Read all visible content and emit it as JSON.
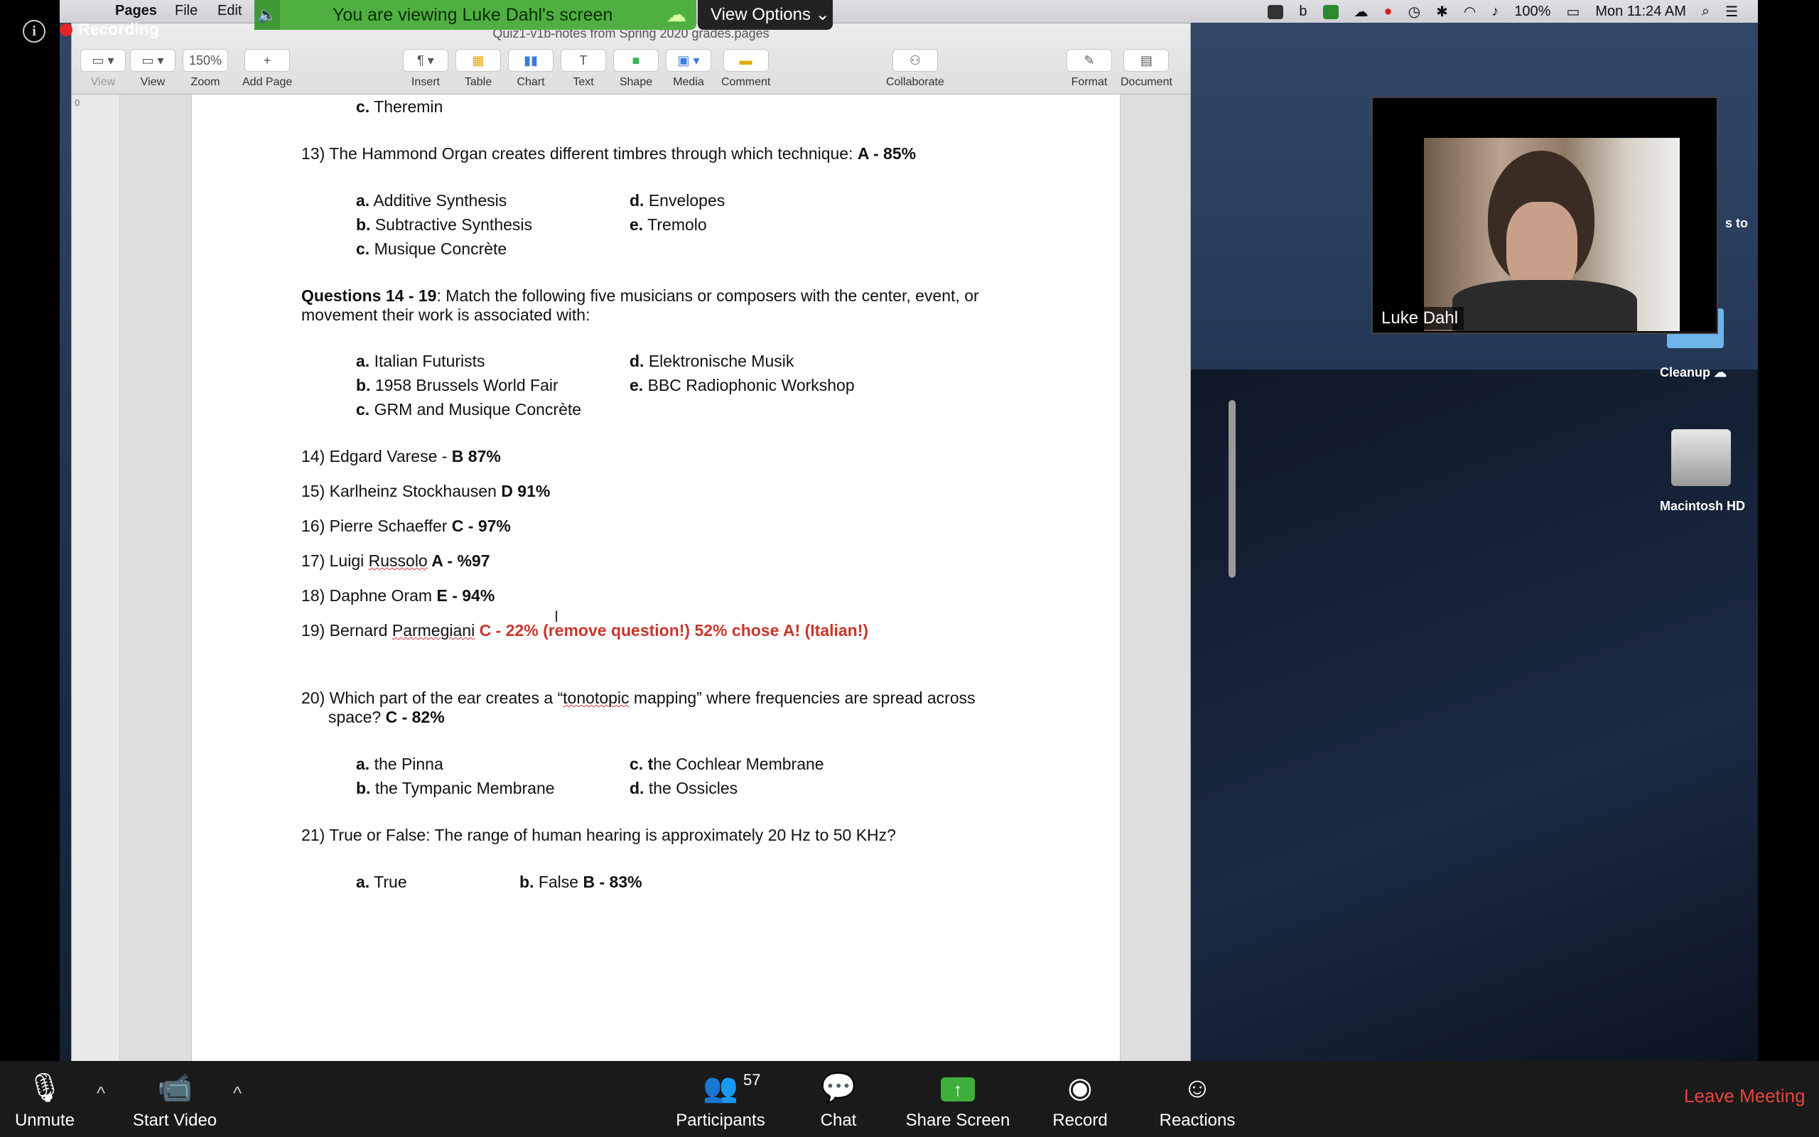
{
  "zoom": {
    "banner_text": "You are viewing Luke Dahl's screen",
    "view_options": "View Options",
    "recording_label": "Recording",
    "participant_name": "Luke Dahl",
    "participants_count": "57",
    "bottom": {
      "unmute": "Unmute",
      "start_video": "Start Video",
      "participants": "Participants",
      "chat": "Chat",
      "share_screen": "Share Screen",
      "record": "Record",
      "reactions": "Reactions",
      "leave": "Leave Meeting"
    },
    "colors": {
      "banner": "#4fb041",
      "share": "#3fae3a",
      "leave": "#e8453c"
    }
  },
  "menubar": {
    "app": "Pages",
    "file": "File",
    "edit": "Edit",
    "battery": "100%",
    "clock": "Mon 11:24 AM"
  },
  "pages": {
    "doc_title": "Quiz1-v1b-notes from Spring 2020 grades.pages",
    "ruler_value": "0",
    "zoom_value": "150%",
    "toolbar": {
      "view_sidebar": "View",
      "view": "View",
      "zoom": "Zoom",
      "add_page": "Add Page",
      "insert": "Insert",
      "table": "Table",
      "chart": "Chart",
      "text": "Text",
      "shape": "Shape",
      "media": "Media",
      "comment": "Comment",
      "collaborate": "Collaborate",
      "format": "Format",
      "document": "Document"
    }
  },
  "doc": {
    "l_theremin_letter": "c.",
    "l_theremin": "Theremin",
    "q13": "13) The Hammond Organ creates different timbres through which technique: ",
    "q13_ans": "A - 85%",
    "q13_opts": {
      "a_l": "a.",
      "a": "Additive Synthesis",
      "b_l": "b.",
      "b": "Subtractive Synthesis",
      "c_l": "c.",
      "c": "Musique Concrète",
      "d_l": "d.",
      "d": "Envelopes",
      "e_l": "e.",
      "e": "Tremolo"
    },
    "q14_head": "Questions 14 - 19",
    "q14_text1": ": Match the following five  musicians or composers with the center, event, or",
    "q14_text2": "movement their work is associated with:",
    "q14_opts": {
      "a_l": "a.",
      "a": "Italian Futurists",
      "b_l": "b.",
      "b": "1958 Brussels World Fair",
      "c_l": "c.",
      "c": "GRM and Musique Concrète",
      "d_l": "d.",
      "d": "Elektronische Musik",
      "e_l": "e.",
      "e": "BBC Radiophonic Workshop"
    },
    "q14": "14) Edgard Varese - ",
    "q14_ans": "B 87%",
    "q15": "15) Karlheinz Stockhausen ",
    "q15_ans": "D 91%",
    "q16": "16) Pierre Schaeffer ",
    "q16_ans": "C - 97%",
    "q17a": "17) Luigi ",
    "q17b": "Russolo",
    "q17_ans": " A - %97",
    "q18": "18) Daphne Oram ",
    "q18_ans": "E - 94%",
    "q19a": "19) Bernard ",
    "q19b": "Parmegiani",
    "q19_ans": " C - 22% (remove question!) 52% chose A! (Italian!)",
    "q20_line1a": "20) Which part of the ear creates a “",
    "q20_line1b": "tonotopic",
    "q20_line1c": " mapping” where frequencies are spread across",
    "q20_line2": "space? ",
    "q20_ans": "C - 82%",
    "q20_opts": {
      "a_l": "a.",
      "a": "the Pinna",
      "b_l": "b.",
      "b": "the Tympanic Membrane",
      "c_l": "c. t",
      "c": "he Cochlear Membrane",
      "d_l": "d.",
      "d": "the Ossicles"
    },
    "q21": "21) True or False: The range of human hearing is approximately 20 Hz to 50 KHz?",
    "q21_opts": {
      "a_l": "a.",
      "a": "True",
      "b_l": "b.",
      "b": "False ",
      "b_ans": "B - 83%"
    }
  },
  "desktop": {
    "cleanup": "Cleanup",
    "hd": "Macintosh HD",
    "partial": "s to"
  }
}
